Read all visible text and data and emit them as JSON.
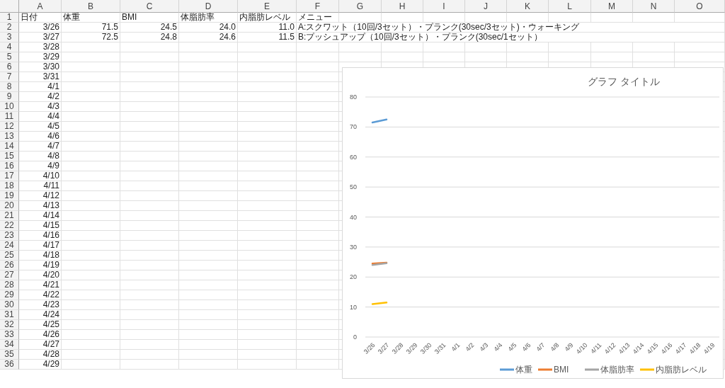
{
  "columns": [
    "A",
    "B",
    "C",
    "D",
    "E",
    "F",
    "G",
    "H",
    "I",
    "J",
    "K",
    "L",
    "M",
    "N",
    "O"
  ],
  "rows": [
    {
      "number": "1",
      "kind": "header",
      "cells": [
        "日付",
        "体重",
        "BMI",
        "体脂肪率",
        "内脂肪レベル",
        "メニュー"
      ]
    },
    {
      "number": "2",
      "kind": "data",
      "cells": [
        "3/26",
        "71.5",
        "24.5",
        "24.0",
        "11.0",
        "A:スクワット（10回/3セット）・プランク(30sec/3セット)・ウォーキング"
      ]
    },
    {
      "number": "3",
      "kind": "data",
      "cells": [
        "3/27",
        "72.5",
        "24.8",
        "24.6",
        "11.5",
        "B:プッシュアップ（10回/3セット）・プランク(30sec/1セット）"
      ]
    },
    {
      "number": "4",
      "kind": "data",
      "cells": [
        "3/28"
      ]
    },
    {
      "number": "5",
      "kind": "data",
      "cells": [
        "3/29"
      ]
    },
    {
      "number": "6",
      "kind": "data",
      "cells": [
        "3/30"
      ]
    },
    {
      "number": "7",
      "kind": "data",
      "cells": [
        "3/31"
      ]
    },
    {
      "number": "8",
      "kind": "data",
      "cells": [
        "4/1"
      ]
    },
    {
      "number": "9",
      "kind": "data",
      "cells": [
        "4/2"
      ]
    },
    {
      "number": "10",
      "kind": "data",
      "cells": [
        "4/3"
      ]
    },
    {
      "number": "11",
      "kind": "data",
      "cells": [
        "4/4"
      ]
    },
    {
      "number": "12",
      "kind": "data",
      "cells": [
        "4/5"
      ]
    },
    {
      "number": "13",
      "kind": "data",
      "cells": [
        "4/6"
      ]
    },
    {
      "number": "14",
      "kind": "data",
      "cells": [
        "4/7"
      ]
    },
    {
      "number": "15",
      "kind": "data",
      "cells": [
        "4/8"
      ]
    },
    {
      "number": "16",
      "kind": "data",
      "cells": [
        "4/9"
      ]
    },
    {
      "number": "17",
      "kind": "data",
      "cells": [
        "4/10"
      ]
    },
    {
      "number": "18",
      "kind": "data",
      "cells": [
        "4/11"
      ]
    },
    {
      "number": "19",
      "kind": "data",
      "cells": [
        "4/12"
      ]
    },
    {
      "number": "20",
      "kind": "data",
      "cells": [
        "4/13"
      ]
    },
    {
      "number": "21",
      "kind": "data",
      "cells": [
        "4/14"
      ]
    },
    {
      "number": "22",
      "kind": "data",
      "cells": [
        "4/15"
      ]
    },
    {
      "number": "23",
      "kind": "data",
      "cells": [
        "4/16"
      ]
    },
    {
      "number": "24",
      "kind": "data",
      "cells": [
        "4/17"
      ]
    },
    {
      "number": "25",
      "kind": "data",
      "cells": [
        "4/18"
      ]
    },
    {
      "number": "26",
      "kind": "data",
      "cells": [
        "4/19"
      ]
    },
    {
      "number": "27",
      "kind": "data",
      "cells": [
        "4/20"
      ]
    },
    {
      "number": "28",
      "kind": "data",
      "cells": [
        "4/21"
      ]
    },
    {
      "number": "29",
      "kind": "data",
      "cells": [
        "4/22"
      ]
    },
    {
      "number": "30",
      "kind": "data",
      "cells": [
        "4/23"
      ]
    },
    {
      "number": "31",
      "kind": "data",
      "cells": [
        "4/24"
      ]
    },
    {
      "number": "32",
      "kind": "data",
      "cells": [
        "4/25"
      ]
    },
    {
      "number": "33",
      "kind": "data",
      "cells": [
        "4/26"
      ]
    },
    {
      "number": "34",
      "kind": "data",
      "cells": [
        "4/27"
      ]
    },
    {
      "number": "35",
      "kind": "data",
      "cells": [
        "4/28"
      ]
    },
    {
      "number": "36",
      "kind": "data",
      "cells": [
        "4/29"
      ]
    }
  ],
  "chart": {
    "chart_data": {
      "type": "line",
      "title": "グラフ タイトル",
      "categories": [
        "3/26",
        "3/27",
        "3/28",
        "3/29",
        "3/30",
        "3/31",
        "4/1",
        "4/2",
        "4/3",
        "4/4",
        "4/5",
        "4/6",
        "4/7",
        "4/8",
        "4/9",
        "4/10",
        "4/11",
        "4/12",
        "4/13",
        "4/14",
        "4/15",
        "4/16",
        "4/17",
        "4/18",
        "4/19"
      ],
      "series": [
        {
          "name": "体重",
          "color": "#5b9bd5",
          "values": [
            71.5,
            72.5,
            null,
            null,
            null,
            null,
            null,
            null,
            null,
            null,
            null,
            null,
            null,
            null,
            null,
            null,
            null,
            null,
            null,
            null,
            null,
            null,
            null,
            null,
            null
          ]
        },
        {
          "name": "BMI",
          "color": "#ed7d31",
          "values": [
            24.5,
            24.8,
            null,
            null,
            null,
            null,
            null,
            null,
            null,
            null,
            null,
            null,
            null,
            null,
            null,
            null,
            null,
            null,
            null,
            null,
            null,
            null,
            null,
            null,
            null
          ]
        },
        {
          "name": "体脂肪率",
          "color": "#a5a5a5",
          "values": [
            24.0,
            24.6,
            null,
            null,
            null,
            null,
            null,
            null,
            null,
            null,
            null,
            null,
            null,
            null,
            null,
            null,
            null,
            null,
            null,
            null,
            null,
            null,
            null,
            null,
            null
          ]
        },
        {
          "name": "内脂肪レベル",
          "color": "#ffc000",
          "values": [
            11.0,
            11.5,
            null,
            null,
            null,
            null,
            null,
            null,
            null,
            null,
            null,
            null,
            null,
            null,
            null,
            null,
            null,
            null,
            null,
            null,
            null,
            null,
            null,
            null,
            null
          ]
        }
      ],
      "grid": true,
      "legend": true,
      "ylim": [
        0,
        80
      ],
      "yticks": [
        0,
        10,
        20,
        30,
        40,
        50,
        60,
        70,
        80
      ]
    }
  }
}
